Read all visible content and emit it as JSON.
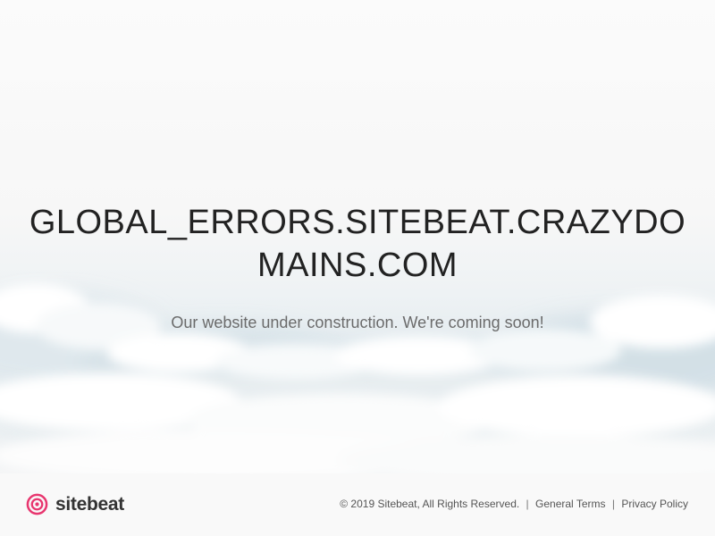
{
  "hero": {
    "domain_title": "GLOBAL_ERRORS.SITEBEAT.CRAZYDOMAINS.COM",
    "subtitle": "Our website under construction. We're coming soon!"
  },
  "footer": {
    "brand_name": "sitebeat",
    "copyright": "© 2019 Sitebeat, All Rights Reserved.",
    "separator": "|",
    "general_terms": "General Terms",
    "privacy_policy": "Privacy Policy"
  },
  "colors": {
    "brand_accent": "#e8366f",
    "title_text": "#222222",
    "subtitle_text": "#6b6b6b"
  },
  "icons": {
    "brand_logo": "sitebeat-logo-icon"
  }
}
